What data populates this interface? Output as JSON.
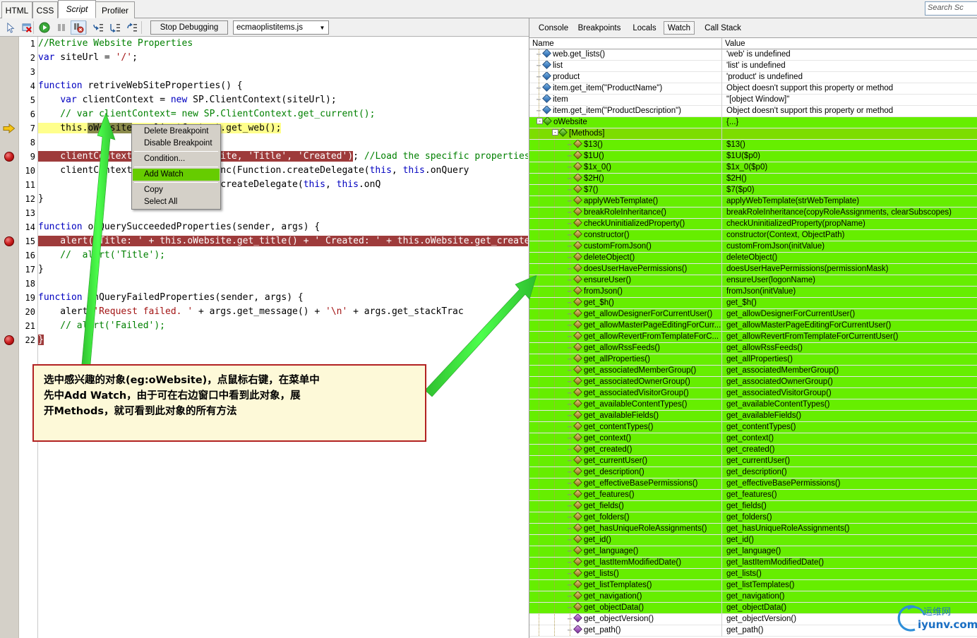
{
  "tabs": [
    {
      "label": "HTML",
      "selected": false
    },
    {
      "label": "CSS",
      "selected": false
    },
    {
      "label": "Script",
      "selected": true
    },
    {
      "label": "Profiler",
      "selected": false
    }
  ],
  "search": {
    "value": "",
    "placeholder": "Search Sc"
  },
  "toolbar": {
    "icons": [
      "select-element-icon",
      "clear-icon",
      "run-icon",
      "pause-icon",
      "break-all-icon",
      "step-into-icon",
      "step-over-icon",
      "step-out-icon"
    ],
    "stop_debugging_label": "Stop Debugging",
    "file_selected": "ecmaoplistitems.js",
    "caret": "▼"
  },
  "code": {
    "lines": [
      {
        "n": 1,
        "breakpoint": false,
        "current": false
      },
      {
        "n": 2,
        "breakpoint": false,
        "current": false
      },
      {
        "n": 3,
        "breakpoint": false,
        "current": false
      },
      {
        "n": 4,
        "breakpoint": false,
        "current": false
      },
      {
        "n": 5,
        "breakpoint": false,
        "current": false
      },
      {
        "n": 6,
        "breakpoint": false,
        "current": false
      },
      {
        "n": 7,
        "breakpoint": false,
        "current": true
      },
      {
        "n": 8,
        "breakpoint": false,
        "current": false
      },
      {
        "n": 9,
        "breakpoint": true,
        "current": false
      },
      {
        "n": 10,
        "breakpoint": false,
        "current": false
      },
      {
        "n": 11,
        "breakpoint": false,
        "current": false
      },
      {
        "n": 12,
        "breakpoint": false,
        "current": false
      },
      {
        "n": 13,
        "breakpoint": false,
        "current": false
      },
      {
        "n": 14,
        "breakpoint": false,
        "current": false
      },
      {
        "n": 15,
        "breakpoint": true,
        "current": false
      },
      {
        "n": 16,
        "breakpoint": false,
        "current": false
      },
      {
        "n": 17,
        "breakpoint": false,
        "current": false
      },
      {
        "n": 18,
        "breakpoint": false,
        "current": false
      },
      {
        "n": 19,
        "breakpoint": false,
        "current": false
      },
      {
        "n": 20,
        "breakpoint": false,
        "current": false
      },
      {
        "n": 21,
        "breakpoint": false,
        "current": false
      },
      {
        "n": 22,
        "breakpoint": true,
        "current": false
      }
    ],
    "text": {
      "l1": "//Retrive Website Properties",
      "l2": "var siteUrl = '/';",
      "l4": "function retriveWebSiteProperties() {",
      "l5": "    var clientContext = new SP.ClientContext(siteUrl);",
      "l6": "    // var clientContext= new SP.ClientContext.get_current();",
      "l7a": "    this.",
      "l7b": "oWebsite",
      "l7c": " = clientContext.get_web();",
      "l9a": "    clientContext.load(this.oWebsite, 'Title', 'Created');",
      "l9b": "  //Load the specific properties",
      "l10": "    clientContext.executeQueryAsync(Function.createDelegate(this, this.onQuery",
      "l11": "                        Function.createDelegate(this, this.onQ",
      "l12": "}",
      "l14": "function onQuerySucceededProperties(sender, args) {",
      "l15": "    alert('Title: ' + this.oWebsite.get_title() + ' Created: ' + this.oWebsite.get_created());",
      "l16": "    //  alert('Title');",
      "l17": "}",
      "l19": "function onQueryFailedProperties(sender, args) {",
      "l20": "    alert('Request failed. ' + args.get_message() + '\\n' + args.get_stackTrace",
      "l21": "    // alert('Failed');",
      "l22": "}"
    }
  },
  "context_menu": {
    "items": [
      {
        "label": "Delete Breakpoint",
        "highlighted": false,
        "separator_after": false
      },
      {
        "label": "Disable Breakpoint",
        "highlighted": false,
        "separator_after": true
      },
      {
        "label": "Condition...",
        "highlighted": false,
        "separator_after": true
      },
      {
        "label": "Add Watch",
        "highlighted": true,
        "separator_after": true
      },
      {
        "label": "Copy",
        "highlighted": false,
        "separator_after": false
      },
      {
        "label": "Select All",
        "highlighted": false,
        "separator_after": false
      }
    ]
  },
  "annotation": {
    "line1": "选中感兴趣的对象(eg:oWebsite)，点鼠标右键，在菜单中",
    "line2": "先中Add Watch，由于可在右边窗口中看到此对象，展",
    "line3": "开Methods，就可看到此对象的所有方法"
  },
  "watch": {
    "tabs": [
      {
        "label": "Console",
        "selected": false
      },
      {
        "label": "Breakpoints",
        "selected": false
      },
      {
        "label": "Locals",
        "selected": false
      },
      {
        "label": "Watch",
        "selected": true
      },
      {
        "label": "Call Stack",
        "selected": false
      }
    ],
    "columns": {
      "name": "Name",
      "value": "Value"
    },
    "rows": [
      {
        "name": "web.get_lists()",
        "value": "'web' is undefined",
        "depth": 1,
        "icon": "blue",
        "bg": "white",
        "expander": null
      },
      {
        "name": "list",
        "value": "'list' is undefined",
        "depth": 1,
        "icon": "blue",
        "bg": "white",
        "expander": null
      },
      {
        "name": "product",
        "value": "'product' is undefined",
        "depth": 1,
        "icon": "blue",
        "bg": "white",
        "expander": null
      },
      {
        "name": "item.get_item(\"ProductName\")",
        "value": "Object doesn't support this property or method",
        "depth": 1,
        "icon": "blue",
        "bg": "white",
        "expander": null
      },
      {
        "name": "item",
        "value": "\"[object Window]\"",
        "depth": 1,
        "icon": "blue",
        "bg": "white",
        "expander": null
      },
      {
        "name": "item.get_item(\"ProductDescription\")",
        "value": "Object doesn't support this property or method",
        "depth": 1,
        "icon": "blue",
        "bg": "white",
        "expander": null
      },
      {
        "name": "oWebsite",
        "value": "{...}",
        "depth": 1,
        "icon": "green",
        "bg": "g1",
        "expander": "-"
      },
      {
        "name": "[Methods]",
        "value": "",
        "depth": 2,
        "icon": "green",
        "bg": "g2",
        "expander": "-"
      },
      {
        "name": "$13()",
        "value": "$13()",
        "depth": 3,
        "icon": "gold",
        "bg": "g1",
        "expander": null
      },
      {
        "name": "$1U()",
        "value": "$1U($p0)",
        "depth": 3,
        "icon": "gold",
        "bg": "g1",
        "expander": null
      },
      {
        "name": "$1x_0()",
        "value": "$1x_0($p0)",
        "depth": 3,
        "icon": "gold",
        "bg": "g1",
        "expander": null
      },
      {
        "name": "$2H()",
        "value": "$2H()",
        "depth": 3,
        "icon": "gold",
        "bg": "g1",
        "expander": null
      },
      {
        "name": "$7()",
        "value": "$7($p0)",
        "depth": 3,
        "icon": "gold",
        "bg": "g1",
        "expander": null
      },
      {
        "name": "applyWebTemplate()",
        "value": "applyWebTemplate(strWebTemplate)",
        "depth": 3,
        "icon": "gold",
        "bg": "g1",
        "expander": null
      },
      {
        "name": "breakRoleInheritance()",
        "value": "breakRoleInheritance(copyRoleAssignments, clearSubscopes)",
        "depth": 3,
        "icon": "gold",
        "bg": "g1",
        "expander": null
      },
      {
        "name": "checkUninitializedProperty()",
        "value": "checkUninitializedProperty(propName)",
        "depth": 3,
        "icon": "gold",
        "bg": "g1",
        "expander": null
      },
      {
        "name": "constructor()",
        "value": "constructor(Context, ObjectPath)",
        "depth": 3,
        "icon": "gold",
        "bg": "g1",
        "expander": null
      },
      {
        "name": "customFromJson()",
        "value": "customFromJson(initValue)",
        "depth": 3,
        "icon": "gold",
        "bg": "g1",
        "expander": null
      },
      {
        "name": "deleteObject()",
        "value": "deleteObject()",
        "depth": 3,
        "icon": "gold",
        "bg": "g1",
        "expander": null
      },
      {
        "name": "doesUserHavePermissions()",
        "value": "doesUserHavePermissions(permissionMask)",
        "depth": 3,
        "icon": "gold",
        "bg": "g1",
        "expander": null
      },
      {
        "name": "ensureUser()",
        "value": "ensureUser(logonName)",
        "depth": 3,
        "icon": "gold",
        "bg": "g1",
        "expander": null
      },
      {
        "name": "fromJson()",
        "value": "fromJson(initValue)",
        "depth": 3,
        "icon": "gold",
        "bg": "g1",
        "expander": null
      },
      {
        "name": "get_$h()",
        "value": "get_$h()",
        "depth": 3,
        "icon": "gold",
        "bg": "g1",
        "expander": null
      },
      {
        "name": "get_allowDesignerForCurrentUser()",
        "value": "get_allowDesignerForCurrentUser()",
        "depth": 3,
        "icon": "gold",
        "bg": "g1",
        "expander": null
      },
      {
        "name": "get_allowMasterPageEditingForCurr...",
        "value": "get_allowMasterPageEditingForCurrentUser()",
        "depth": 3,
        "icon": "gold",
        "bg": "g1",
        "expander": null
      },
      {
        "name": "get_allowRevertFromTemplateForC...",
        "value": "get_allowRevertFromTemplateForCurrentUser()",
        "depth": 3,
        "icon": "gold",
        "bg": "g1",
        "expander": null
      },
      {
        "name": "get_allowRssFeeds()",
        "value": "get_allowRssFeeds()",
        "depth": 3,
        "icon": "gold",
        "bg": "g1",
        "expander": null
      },
      {
        "name": "get_allProperties()",
        "value": "get_allProperties()",
        "depth": 3,
        "icon": "gold",
        "bg": "g1",
        "expander": null
      },
      {
        "name": "get_associatedMemberGroup()",
        "value": "get_associatedMemberGroup()",
        "depth": 3,
        "icon": "gold",
        "bg": "g1",
        "expander": null
      },
      {
        "name": "get_associatedOwnerGroup()",
        "value": "get_associatedOwnerGroup()",
        "depth": 3,
        "icon": "gold",
        "bg": "g1",
        "expander": null
      },
      {
        "name": "get_associatedVisitorGroup()",
        "value": "get_associatedVisitorGroup()",
        "depth": 3,
        "icon": "gold",
        "bg": "g1",
        "expander": null
      },
      {
        "name": "get_availableContentTypes()",
        "value": "get_availableContentTypes()",
        "depth": 3,
        "icon": "gold",
        "bg": "g1",
        "expander": null
      },
      {
        "name": "get_availableFields()",
        "value": "get_availableFields()",
        "depth": 3,
        "icon": "gold",
        "bg": "g1",
        "expander": null
      },
      {
        "name": "get_contentTypes()",
        "value": "get_contentTypes()",
        "depth": 3,
        "icon": "gold",
        "bg": "g1",
        "expander": null
      },
      {
        "name": "get_context()",
        "value": "get_context()",
        "depth": 3,
        "icon": "gold",
        "bg": "g1",
        "expander": null
      },
      {
        "name": "get_created()",
        "value": "get_created()",
        "depth": 3,
        "icon": "gold",
        "bg": "g1",
        "expander": null
      },
      {
        "name": "get_currentUser()",
        "value": "get_currentUser()",
        "depth": 3,
        "icon": "gold",
        "bg": "g1",
        "expander": null
      },
      {
        "name": "get_description()",
        "value": "get_description()",
        "depth": 3,
        "icon": "gold",
        "bg": "g1",
        "expander": null
      },
      {
        "name": "get_effectiveBasePermissions()",
        "value": "get_effectiveBasePermissions()",
        "depth": 3,
        "icon": "gold",
        "bg": "g1",
        "expander": null
      },
      {
        "name": "get_features()",
        "value": "get_features()",
        "depth": 3,
        "icon": "gold",
        "bg": "g1",
        "expander": null
      },
      {
        "name": "get_fields()",
        "value": "get_fields()",
        "depth": 3,
        "icon": "gold",
        "bg": "g1",
        "expander": null
      },
      {
        "name": "get_folders()",
        "value": "get_folders()",
        "depth": 3,
        "icon": "gold",
        "bg": "g1",
        "expander": null
      },
      {
        "name": "get_hasUniqueRoleAssignments()",
        "value": "get_hasUniqueRoleAssignments()",
        "depth": 3,
        "icon": "gold",
        "bg": "g1",
        "expander": null
      },
      {
        "name": "get_id()",
        "value": "get_id()",
        "depth": 3,
        "icon": "gold",
        "bg": "g1",
        "expander": null
      },
      {
        "name": "get_language()",
        "value": "get_language()",
        "depth": 3,
        "icon": "gold",
        "bg": "g1",
        "expander": null
      },
      {
        "name": "get_lastItemModifiedDate()",
        "value": "get_lastItemModifiedDate()",
        "depth": 3,
        "icon": "gold",
        "bg": "g1",
        "expander": null
      },
      {
        "name": "get_lists()",
        "value": "get_lists()",
        "depth": 3,
        "icon": "gold",
        "bg": "g1",
        "expander": null
      },
      {
        "name": "get_listTemplates()",
        "value": "get_listTemplates()",
        "depth": 3,
        "icon": "gold",
        "bg": "g1",
        "expander": null
      },
      {
        "name": "get_navigation()",
        "value": "get_navigation()",
        "depth": 3,
        "icon": "gold",
        "bg": "g1",
        "expander": null
      },
      {
        "name": "get_objectData()",
        "value": "get_objectData()",
        "depth": 3,
        "icon": "gold",
        "bg": "g1",
        "expander": null
      },
      {
        "name": "get_objectVersion()",
        "value": "get_objectVersion()",
        "depth": 3,
        "icon": "purple",
        "bg": "white",
        "expander": null
      },
      {
        "name": "get_path()",
        "value": "get_path()",
        "depth": 3,
        "icon": "purple",
        "bg": "white",
        "expander": null
      }
    ]
  },
  "watermark": {
    "text": "运维网",
    "url": "iyunv.com"
  }
}
